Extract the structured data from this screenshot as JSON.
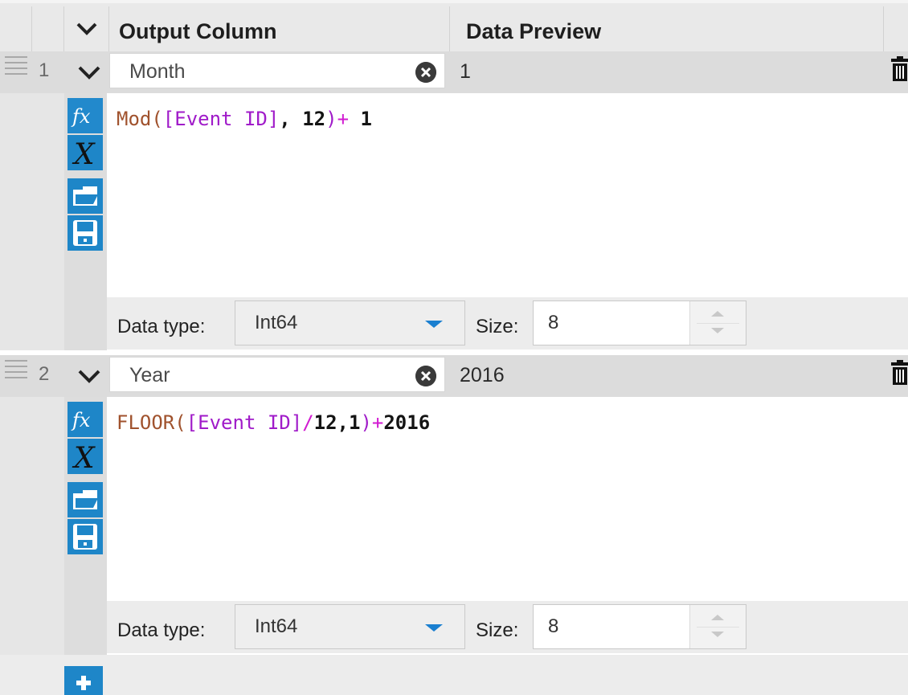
{
  "header": {
    "output_column_label": "Output Column",
    "data_preview_label": "Data Preview"
  },
  "rows": [
    {
      "number": "1",
      "name": "Month",
      "preview": "1",
      "expression": {
        "fn": "Mod(",
        "field": "[Event ID]",
        "p1": ", ",
        "n1": "12",
        "p2": ")",
        "op": "+ ",
        "n2": "1"
      },
      "data_type_label": "Data type:",
      "data_type": "Int64",
      "size_label": "Size:",
      "size": "8"
    },
    {
      "number": "2",
      "name": "Year",
      "preview": "2016",
      "expression": {
        "fn": "FLOOR(",
        "field": "[Event ID]",
        "op1": "/",
        "n1": "12,1",
        "p1": ")",
        "op2": "+",
        "n2": "2016"
      },
      "data_type_label": "Data type:",
      "data_type": "Int64",
      "size_label": "Size:",
      "size": "8"
    }
  ],
  "icons": {
    "formula": "fx-icon",
    "variable": "x-variable-icon",
    "open": "open-folder-icon",
    "save": "floppy-save-icon",
    "delete": "trash-icon",
    "clear": "clear-circle-icon",
    "expand": "chevron-down-icon",
    "add": "plus-icon"
  },
  "colors": {
    "accent": "#1e86c8",
    "function": "#a0522d",
    "field": "#a01bc9",
    "operator": "#d11ad1"
  }
}
